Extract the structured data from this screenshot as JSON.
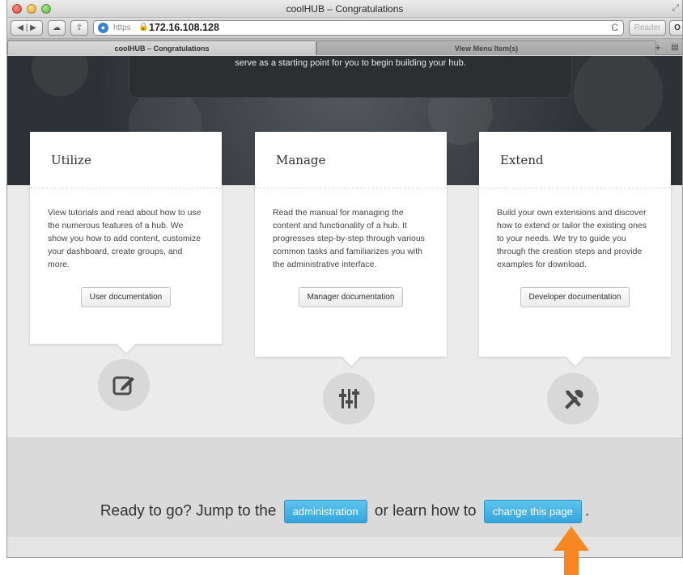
{
  "browser": {
    "window_title": "coolHUB – Congratulations",
    "url_scheme": "https",
    "url_host": "172.16.108.128",
    "reload_glyph": "C",
    "reader_label": "Reader",
    "tabs": [
      {
        "label": "coolHUB – Congratulations",
        "active": true
      },
      {
        "label": "View Menu Item(s)",
        "active": false
      }
    ],
    "new_tab_glyph": "+"
  },
  "hero": {
    "text": "serve as a starting point for you to begin building your hub."
  },
  "cards": [
    {
      "title": "Utilize",
      "body": "View tutorials and read about how to use the numerous features of a hub. We show you how to add content, customize your dashboard, create groups, and more.",
      "button": "User documentation",
      "icon": "edit-icon"
    },
    {
      "title": "Manage",
      "body": "Read the manual for managing the content and functionality of a hub. It progresses step-by-step through various common tasks and familiarizes you with the administrative interface.",
      "button": "Manager documentation",
      "icon": "sliders-icon"
    },
    {
      "title": "Extend",
      "body": "Build your own extensions and discover how to extend or tailor the existing ones to your needs. We try to guide you through the creation steps and provide examples for download.",
      "button": "Developer documentation",
      "icon": "tools-icon"
    }
  ],
  "cta": {
    "text_before": "Ready to go? Jump to the",
    "admin_button": "administration",
    "text_middle": "or learn how to",
    "change_button": "change this page",
    "text_after": "."
  },
  "colors": {
    "accent_blue": "#3aa8de",
    "annotation_arrow": "#f7871e"
  }
}
